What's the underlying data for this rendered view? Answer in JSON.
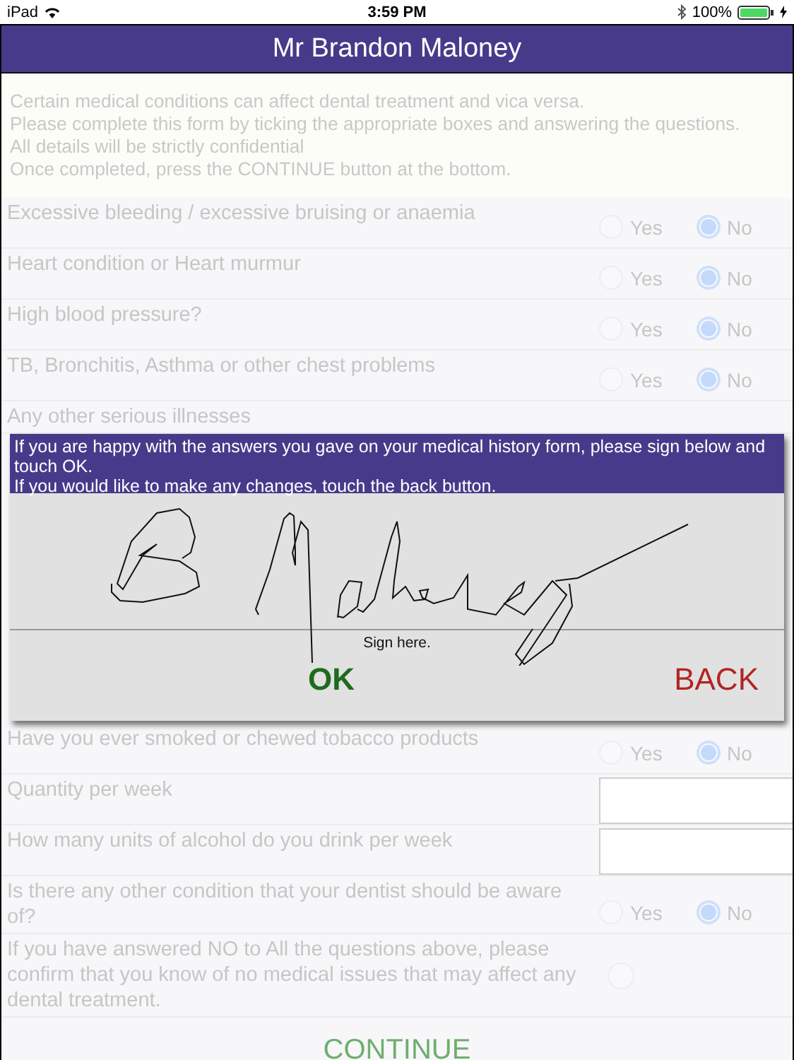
{
  "status_bar": {
    "device": "iPad",
    "time": "3:59 PM",
    "battery": "100%"
  },
  "title": "Mr Brandon Maloney",
  "intro": [
    "Certain medical conditions can affect dental treatment and vica versa.",
    "Please complete this form by ticking the appropriate boxes and answering the questions.",
    "All details will be strictly confidential",
    "Once completed, press the CONTINUE button at the bottom."
  ],
  "questions_top": [
    {
      "kind": "yesno",
      "text": "Excessive bleeding / excessive bruising or anaemia",
      "options": [
        {
          "label": "Yes",
          "selected": false
        },
        {
          "label": "No",
          "selected": true
        }
      ]
    },
    {
      "kind": "yesno",
      "text": "Heart condition or Heart murmur",
      "options": [
        {
          "label": "Yes",
          "selected": false
        },
        {
          "label": "No",
          "selected": true
        }
      ]
    },
    {
      "kind": "yesno",
      "text": "High blood pressure?",
      "options": [
        {
          "label": "Yes",
          "selected": false
        },
        {
          "label": "No",
          "selected": true
        }
      ]
    },
    {
      "kind": "yesno",
      "text": "TB, Bronchitis, Asthma or other chest problems",
      "options": [
        {
          "label": "Yes",
          "selected": false
        },
        {
          "label": "No",
          "selected": true
        }
      ]
    },
    {
      "kind": "plain",
      "text": "Any other serious illnesses"
    }
  ],
  "signature_dialog": {
    "message": [
      "If you are happy with the answers you gave on your medical history form, please sign below and touch OK.",
      "If you would like to make any changes, touch the back button."
    ],
    "hint": "Sign here.",
    "ok": "OK",
    "back": "BACK"
  },
  "questions_bottom": [
    {
      "kind": "yesno",
      "text": "Have you ever smoked or chewed tobacco products",
      "options": [
        {
          "label": "Yes",
          "selected": false
        },
        {
          "label": "No",
          "selected": true
        }
      ]
    },
    {
      "kind": "input",
      "text": "Quantity per week"
    },
    {
      "kind": "input",
      "text": "How many units of alcohol do you drink per week"
    },
    {
      "kind": "yesno",
      "text": "Is there any other condition that your dentist should be aware of?",
      "options": [
        {
          "label": "Yes",
          "selected": false
        },
        {
          "label": "No",
          "selected": true
        }
      ]
    },
    {
      "kind": "confirm",
      "text": "If you have answered NO to All the questions above, please confirm that you know of no medical issues that may affect any dental treatment.",
      "checked": false
    }
  ],
  "continue": "CONTINUE"
}
